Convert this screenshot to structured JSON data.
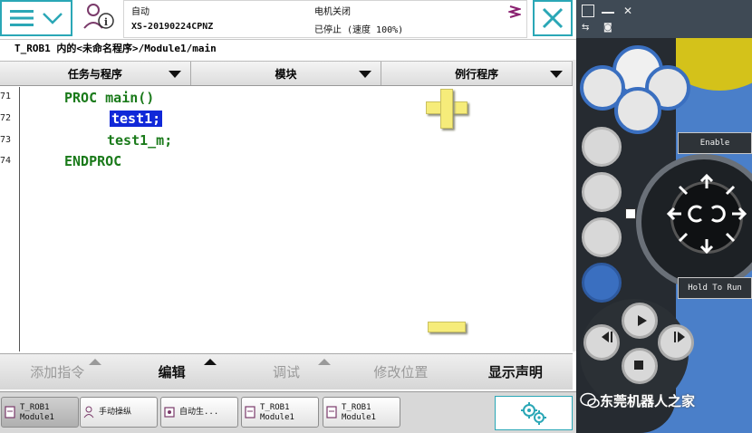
{
  "header": {
    "mode": "自动",
    "controller": "XS-20190224CPNZ",
    "motor_status": "电机关闭",
    "run_status": "已停止 (速度 100%)"
  },
  "breadcrumb": "T_ROB1 内的<未命名程序>/Module1/main",
  "tabs": [
    {
      "label": "任务与程序"
    },
    {
      "label": "模块"
    },
    {
      "label": "例行程序"
    }
  ],
  "editor": {
    "lines": [
      {
        "num": "71",
        "text": "PROC main()"
      },
      {
        "num": "72",
        "text": "test1;"
      },
      {
        "num": "73",
        "text": "test1_m;"
      },
      {
        "num": "74",
        "text": "ENDPROC"
      }
    ]
  },
  "toolbar": {
    "add_instruction": "添加指令",
    "edit": "编辑",
    "debug": "调试",
    "modify_position": "修改位置",
    "show_declarations": "显示声明"
  },
  "taskbar": [
    {
      "line1": "T_ROB1",
      "line2": "Module1"
    },
    {
      "line1": "手动操纵",
      "line2": ""
    },
    {
      "line1": "自动生...",
      "line2": ""
    },
    {
      "line1": "T_ROB1",
      "line2": "Module1"
    },
    {
      "line1": "T_ROB1",
      "line2": "Module1"
    }
  ],
  "hardware": {
    "enable_label": "Enable",
    "hold_label": "Hold To Run"
  },
  "watermark": "东莞机器人之家",
  "colors": {
    "accent": "#2aa7b6",
    "code_green": "#1a7a1a",
    "selection": "#1028d8",
    "overlay_yellow": "#f6ec7a",
    "hw_blue": "#4a7fc9"
  }
}
